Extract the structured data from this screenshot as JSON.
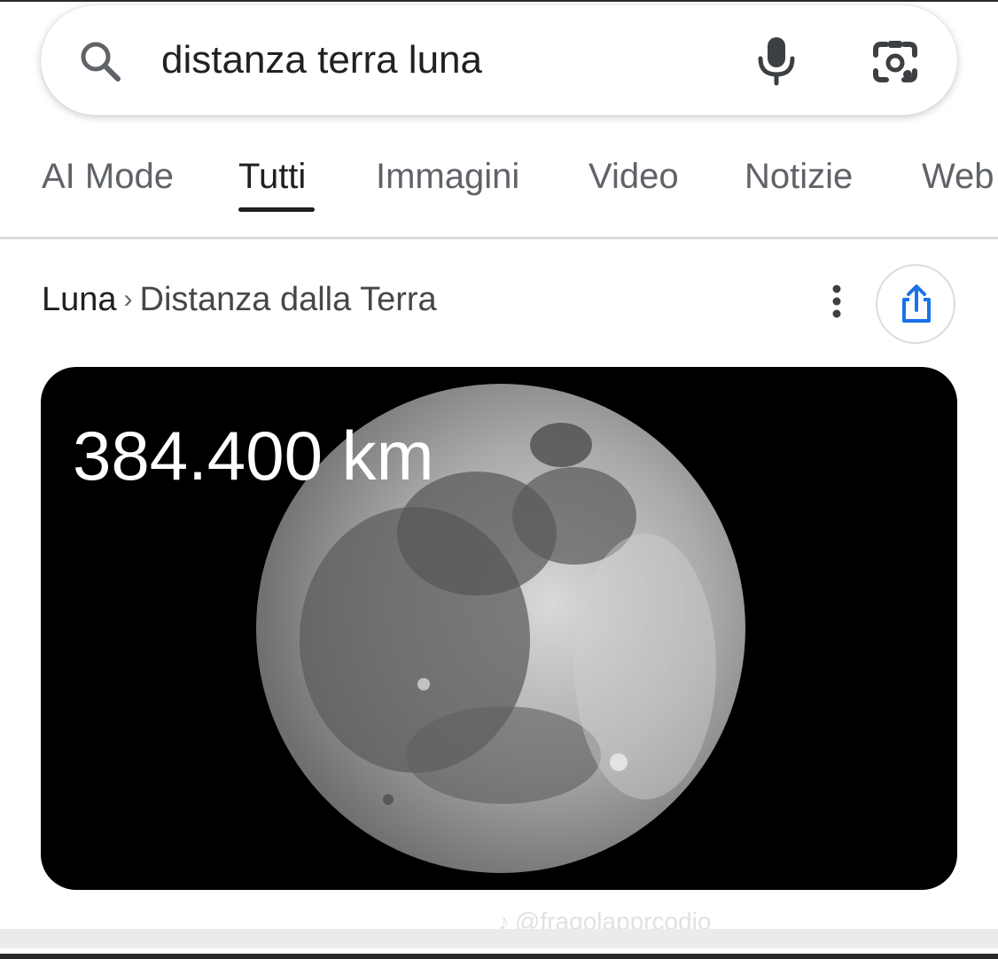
{
  "search": {
    "query": "distanza terra luna"
  },
  "tabs": [
    {
      "label": "AI Mode",
      "active": false
    },
    {
      "label": "Tutti",
      "active": true
    },
    {
      "label": "Immagini",
      "active": false
    },
    {
      "label": "Video",
      "active": false
    },
    {
      "label": "Notizie",
      "active": false
    },
    {
      "label": "Web",
      "active": false
    }
  ],
  "breadcrumb": {
    "root": "Luna",
    "separator": "›",
    "leaf": "Distanza dalla Terra"
  },
  "answer": {
    "value": "384.400 km",
    "image": "moon-photo"
  },
  "watermark": {
    "mark": "♪",
    "text": "@fragolapprcodio"
  },
  "colors": {
    "share_icon": "#1a73e8",
    "card_background": "#000000",
    "active_tab": "#1f1f1f",
    "inactive_tab": "#5f6368"
  },
  "icons": [
    "search-icon",
    "mic-icon",
    "google-lens-icon",
    "more-vert-icon",
    "share-icon"
  ]
}
